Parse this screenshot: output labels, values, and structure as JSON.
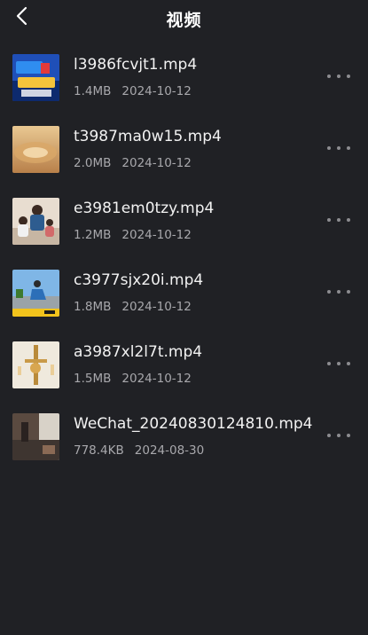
{
  "header": {
    "title": "视频"
  },
  "files": [
    {
      "name": "l3986fcvjt1.mp4",
      "size": "1.4MB",
      "date": "2024-10-12"
    },
    {
      "name": "t3987ma0w15.mp4",
      "size": "2.0MB",
      "date": "2024-10-12"
    },
    {
      "name": "e3981em0tzy.mp4",
      "size": "1.2MB",
      "date": "2024-10-12"
    },
    {
      "name": "c3977sjx20i.mp4",
      "size": "1.8MB",
      "date": "2024-10-12"
    },
    {
      "name": "a3987xl2l7t.mp4",
      "size": "1.5MB",
      "date": "2024-10-12"
    },
    {
      "name": "WeChat_20240830124810.mp4",
      "size": "778.4KB",
      "date": "2024-08-30"
    }
  ],
  "icons": {
    "back": "chevron-left-icon",
    "more": "more-horizontal-icon"
  },
  "colors": {
    "background": "#202125",
    "text_primary": "#f2f2f2",
    "text_secondary": "#a8a8ac"
  }
}
